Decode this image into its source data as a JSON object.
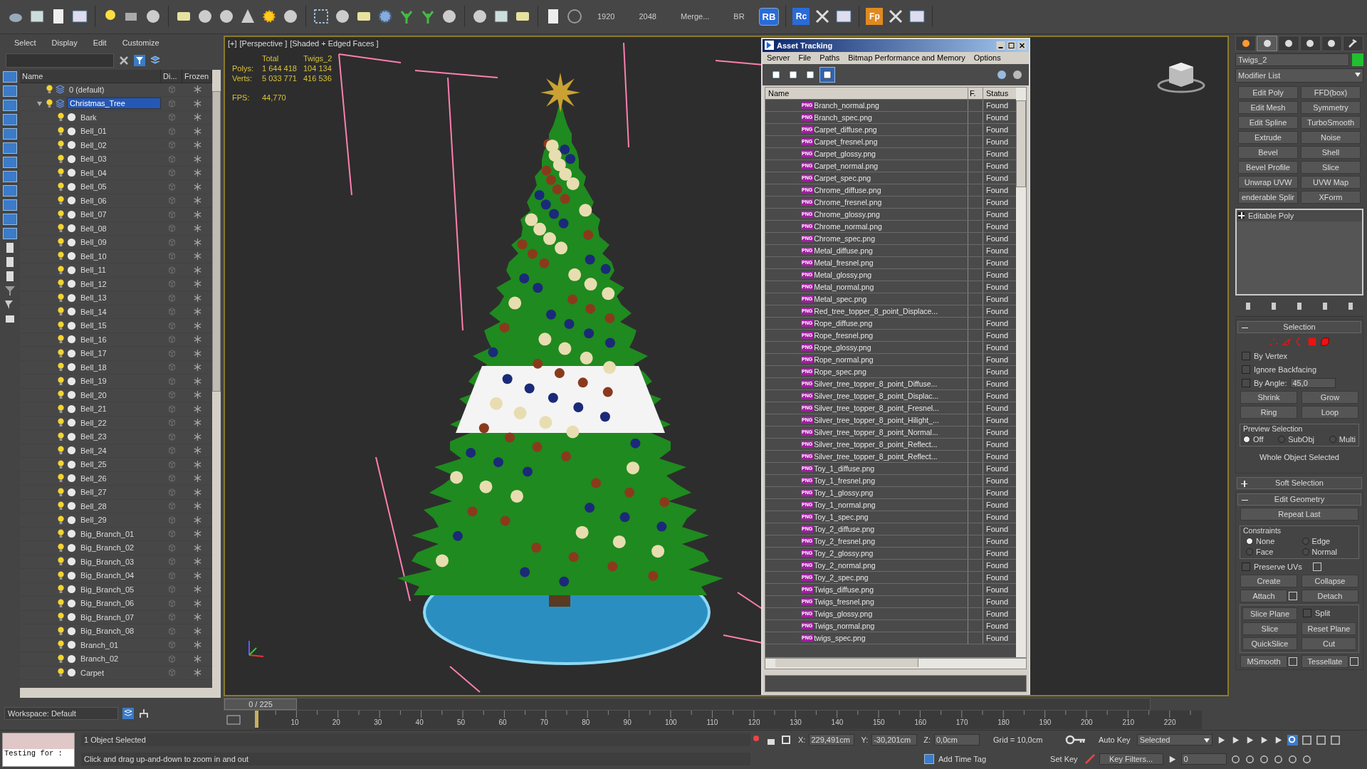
{
  "toolbar": {
    "readouts": [
      "1920",
      "2048",
      "Merge...",
      "BR"
    ],
    "rb_button": "RB",
    "plugin_buttons": [
      {
        "label": "Rc"
      },
      {
        "label": "Fp"
      }
    ]
  },
  "scene_explorer": {
    "menu": [
      "Select",
      "Display",
      "Edit",
      "Customize"
    ],
    "columns": [
      "Name",
      "Di...",
      "Frozen"
    ],
    "tree": [
      {
        "name": "0 (default)",
        "kind": "layer",
        "selected": false
      },
      {
        "name": "Christmas_Tree",
        "kind": "layer",
        "selected": true,
        "expanded": true,
        "children": [
          {
            "name": "Bark",
            "selected": false
          },
          {
            "name": "Bell_01",
            "selected": false
          },
          {
            "name": "Bell_02",
            "selected": false
          },
          {
            "name": "Bell_03",
            "selected": false
          },
          {
            "name": "Bell_04",
            "selected": false
          },
          {
            "name": "Bell_05",
            "selected": false
          },
          {
            "name": "Bell_06",
            "selected": false
          },
          {
            "name": "Bell_07",
            "selected": false
          },
          {
            "name": "Bell_08",
            "selected": false
          },
          {
            "name": "Bell_09",
            "selected": false
          },
          {
            "name": "Bell_10",
            "selected": false
          },
          {
            "name": "Bell_11",
            "selected": false
          },
          {
            "name": "Bell_12",
            "selected": false
          },
          {
            "name": "Bell_13",
            "selected": false
          },
          {
            "name": "Bell_14",
            "selected": false
          },
          {
            "name": "Bell_15",
            "selected": false
          },
          {
            "name": "Bell_16",
            "selected": false
          },
          {
            "name": "Bell_17",
            "selected": false
          },
          {
            "name": "Bell_18",
            "selected": false
          },
          {
            "name": "Bell_19",
            "selected": false
          },
          {
            "name": "Bell_20",
            "selected": false
          },
          {
            "name": "Bell_21",
            "selected": false
          },
          {
            "name": "Bell_22",
            "selected": false
          },
          {
            "name": "Bell_23",
            "selected": false
          },
          {
            "name": "Bell_24",
            "selected": false
          },
          {
            "name": "Bell_25",
            "selected": false
          },
          {
            "name": "Bell_26",
            "selected": false
          },
          {
            "name": "Bell_27",
            "selected": false
          },
          {
            "name": "Bell_28",
            "selected": false
          },
          {
            "name": "Bell_29",
            "selected": false
          },
          {
            "name": "Big_Branch_01",
            "selected": false
          },
          {
            "name": "Big_Branch_02",
            "selected": false
          },
          {
            "name": "Big_Branch_03",
            "selected": false
          },
          {
            "name": "Big_Branch_04",
            "selected": false
          },
          {
            "name": "Big_Branch_05",
            "selected": false
          },
          {
            "name": "Big_Branch_06",
            "selected": false
          },
          {
            "name": "Big_Branch_07",
            "selected": false
          },
          {
            "name": "Big_Branch_08",
            "selected": false
          },
          {
            "name": "Branch_01",
            "selected": false
          },
          {
            "name": "Branch_02",
            "selected": false
          },
          {
            "name": "Carpet",
            "selected": false
          }
        ]
      }
    ]
  },
  "viewport": {
    "labels": [
      "[+]",
      "[Perspective ]",
      "[Shaded + Edged Faces ]"
    ],
    "stat_headers": [
      "Total",
      "Twigs_2"
    ],
    "stats": [
      {
        "label": "Polys:",
        "total": "1 644 418",
        "selection": "104 134"
      },
      {
        "label": "Verts:",
        "total": "5 033 771",
        "selection": "416 536"
      }
    ],
    "fps_label": "FPS:",
    "fps": "44,770"
  },
  "asset_tracking": {
    "title": "Asset Tracking",
    "menu": [
      "Server",
      "File",
      "Paths",
      "Bitmap Performance and Memory",
      "Options"
    ],
    "view_buttons": [
      {
        "selected": false
      },
      {
        "selected": false
      },
      {
        "selected": false
      },
      {
        "selected": true
      }
    ],
    "columns": [
      "Name",
      "F.",
      "Status"
    ],
    "rows": [
      {
        "name": "Branch_normal.png",
        "format": "PNG",
        "status": "Found"
      },
      {
        "name": "Branch_spec.png",
        "format": "PNG",
        "status": "Found"
      },
      {
        "name": "Carpet_diffuse.png",
        "format": "PNG",
        "status": "Found"
      },
      {
        "name": "Carpet_fresnel.png",
        "format": "PNG",
        "status": "Found"
      },
      {
        "name": "Carpet_glossy.png",
        "format": "PNG",
        "status": "Found"
      },
      {
        "name": "Carpet_normal.png",
        "format": "PNG",
        "status": "Found"
      },
      {
        "name": "Carpet_spec.png",
        "format": "PNG",
        "status": "Found"
      },
      {
        "name": "Chrome_diffuse.png",
        "format": "PNG",
        "status": "Found"
      },
      {
        "name": "Chrome_fresnel.png",
        "format": "PNG",
        "status": "Found"
      },
      {
        "name": "Chrome_glossy.png",
        "format": "PNG",
        "status": "Found"
      },
      {
        "name": "Chrome_normal.png",
        "format": "PNG",
        "status": "Found"
      },
      {
        "name": "Chrome_spec.png",
        "format": "PNG",
        "status": "Found"
      },
      {
        "name": "Metal_diffuse.png",
        "format": "PNG",
        "status": "Found"
      },
      {
        "name": "Metal_fresnel.png",
        "format": "PNG",
        "status": "Found"
      },
      {
        "name": "Metal_glossy.png",
        "format": "PNG",
        "status": "Found"
      },
      {
        "name": "Metal_normal.png",
        "format": "PNG",
        "status": "Found"
      },
      {
        "name": "Metal_spec.png",
        "format": "PNG",
        "status": "Found"
      },
      {
        "name": "Red_tree_topper_8_point_Displace...",
        "format": "PNG",
        "status": "Found"
      },
      {
        "name": "Rope_diffuse.png",
        "format": "PNG",
        "status": "Found"
      },
      {
        "name": "Rope_fresnel.png",
        "format": "PNG",
        "status": "Found"
      },
      {
        "name": "Rope_glossy.png",
        "format": "PNG",
        "status": "Found"
      },
      {
        "name": "Rope_normal.png",
        "format": "PNG",
        "status": "Found"
      },
      {
        "name": "Rope_spec.png",
        "format": "PNG",
        "status": "Found"
      },
      {
        "name": "Silver_tree_topper_8_point_Diffuse...",
        "format": "PNG",
        "status": "Found"
      },
      {
        "name": "Silver_tree_topper_8_point_Displac...",
        "format": "PNG",
        "status": "Found"
      },
      {
        "name": "Silver_tree_topper_8_point_Fresnel...",
        "format": "PNG",
        "status": "Found"
      },
      {
        "name": "Silver_tree_topper_8_point_Hilight_...",
        "format": "PNG",
        "status": "Found"
      },
      {
        "name": "Silver_tree_topper_8_point_Normal...",
        "format": "PNG",
        "status": "Found"
      },
      {
        "name": "Silver_tree_topper_8_point_Reflect...",
        "format": "PNG",
        "status": "Found"
      },
      {
        "name": "Silver_tree_topper_8_point_Reflect...",
        "format": "PNG",
        "status": "Found"
      },
      {
        "name": "Toy_1_diffuse.png",
        "format": "PNG",
        "status": "Found"
      },
      {
        "name": "Toy_1_fresnel.png",
        "format": "PNG",
        "status": "Found"
      },
      {
        "name": "Toy_1_glossy.png",
        "format": "PNG",
        "status": "Found"
      },
      {
        "name": "Toy_1_normal.png",
        "format": "PNG",
        "status": "Found"
      },
      {
        "name": "Toy_1_spec.png",
        "format": "PNG",
        "status": "Found"
      },
      {
        "name": "Toy_2_diffuse.png",
        "format": "PNG",
        "status": "Found"
      },
      {
        "name": "Toy_2_fresnel.png",
        "format": "PNG",
        "status": "Found"
      },
      {
        "name": "Toy_2_glossy.png",
        "format": "PNG",
        "status": "Found"
      },
      {
        "name": "Toy_2_normal.png",
        "format": "PNG",
        "status": "Found"
      },
      {
        "name": "Toy_2_spec.png",
        "format": "PNG",
        "status": "Found"
      },
      {
        "name": "Twigs_diffuse.png",
        "format": "PNG",
        "status": "Found"
      },
      {
        "name": "Twigs_fresnel.png",
        "format": "PNG",
        "status": "Found"
      },
      {
        "name": "Twigs_glossy.png",
        "format": "PNG",
        "status": "Found"
      },
      {
        "name": "Twigs_normal.png",
        "format": "PNG",
        "status": "Found"
      },
      {
        "name": "twigs_spec.png",
        "format": "PNG",
        "status": "Found"
      }
    ]
  },
  "command_panel": {
    "tabs": [
      {
        "selected": false
      },
      {
        "selected": true
      },
      {
        "selected": false
      },
      {
        "selected": false
      },
      {
        "selected": false
      },
      {
        "selected": false
      }
    ],
    "object_name": "Twigs_2",
    "modifier_list": "Modifier List",
    "modifier_buttons": [
      "Edit Poly",
      "FFD(box)",
      "Edit Mesh",
      "Symmetry",
      "Edit Spline",
      "TurboSmooth",
      "Extrude",
      "Noise",
      "Bevel",
      "Shell",
      "Bevel Profile",
      "Slice",
      "Unwrap UVW",
      "UVW Map",
      "enderable Splir",
      "XForm"
    ],
    "stack": [
      "Editable Poly"
    ],
    "selection": {
      "title": "Selection",
      "expanded": true,
      "checks": [
        {
          "label": "By Vertex",
          "checked": false
        },
        {
          "label": "Ignore Backfacing",
          "checked": false
        },
        {
          "label": "By Angle:",
          "checked": false,
          "value": "45,0"
        }
      ],
      "buttons": [
        "Shrink",
        "Grow",
        "Ring",
        "Loop"
      ],
      "preview_label": "Preview Selection",
      "preview": [
        {
          "label": "Off",
          "selected": true
        },
        {
          "label": "SubObj",
          "selected": false
        },
        {
          "label": "Multi",
          "selected": false
        }
      ],
      "status": "Whole Object Selected"
    },
    "soft_selection": {
      "title": "Soft Selection",
      "expanded": false
    },
    "edit_geometry": {
      "title": "Edit Geometry",
      "expanded": true,
      "repeat": "Repeat Last",
      "constraints_label": "Constraints",
      "constraints": [
        {
          "label": "None",
          "selected": true
        },
        {
          "label": "Edge",
          "selected": false
        },
        {
          "label": "Face",
          "selected": false
        },
        {
          "label": "Normal",
          "selected": false
        }
      ],
      "preserve_uvs": {
        "label": "Preserve UVs",
        "checked": false
      },
      "buttons": [
        "Create",
        "Collapse",
        "Attach",
        "Detach"
      ],
      "slice_plane": "Slice Plane",
      "split": {
        "label": "Split",
        "checked": false
      },
      "slice_buttons": [
        "Slice",
        "Reset Plane",
        "QuickSlice",
        "Cut"
      ],
      "bottom_buttons": [
        "MSmooth",
        "Tessellate"
      ]
    }
  },
  "timeline": {
    "workspace": "Workspace: Default",
    "frame_slider": "0 / 225",
    "level": 0,
    "ticks": [
      "10",
      "20",
      "30",
      "40",
      "50",
      "60",
      "70",
      "80",
      "90",
      "100",
      "110",
      "120",
      "130",
      "140",
      "150",
      "160",
      "170",
      "180",
      "190",
      "200",
      "210",
      "220"
    ]
  },
  "status_bar": {
    "script_field": "Testing for :",
    "selection_count": "1 Object Selected",
    "prompt": "Click and drag up-and-down to zoom in and out",
    "coords": [
      {
        "axis": "X:",
        "value": "229,491cm"
      },
      {
        "axis": "Y:",
        "value": "-30,201cm"
      },
      {
        "axis": "Z:",
        "value": "0,0cm"
      }
    ],
    "grid": "Grid = 10,0cm",
    "add_time_tag": "Add Time Tag",
    "auto_key": "Auto Key",
    "key_mode": "Selected",
    "set_key": "Set Key",
    "key_filters": "Key Filters...",
    "current_frame": "0"
  }
}
